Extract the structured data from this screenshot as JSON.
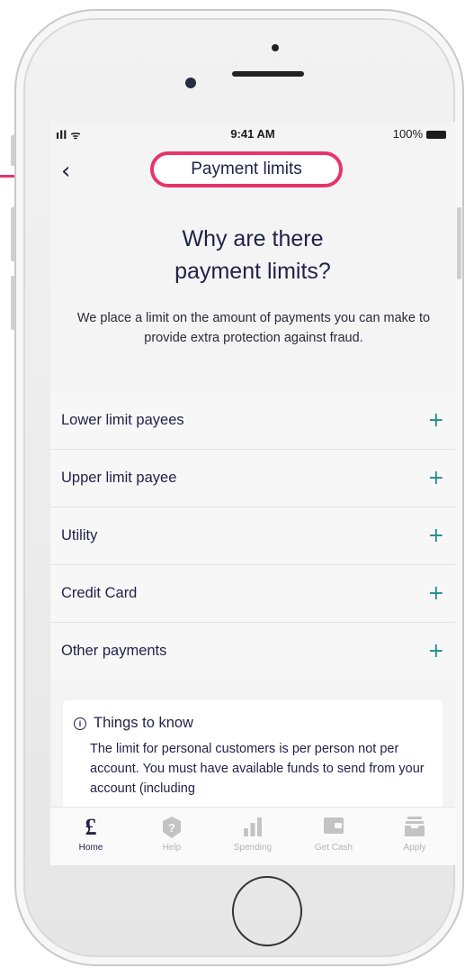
{
  "status": {
    "signal": "ıll ᯤ",
    "time": "9:41 AM",
    "battery": "100%"
  },
  "nav": {
    "title": "Payment limits",
    "back_icon": "chevron-left-icon"
  },
  "hero": {
    "title_line1": "Why are there",
    "title_line2": "payment limits?",
    "description": "We place a limit on the amount of payments you can make to provide extra protection against fraud."
  },
  "accordion": [
    {
      "label": "Lower limit payees",
      "icon": "plus-icon"
    },
    {
      "label": "Upper limit payee",
      "icon": "plus-icon"
    },
    {
      "label": "Utility",
      "icon": "plus-icon"
    },
    {
      "label": "Credit Card",
      "icon": "plus-icon"
    },
    {
      "label": "Other payments",
      "icon": "plus-icon"
    }
  ],
  "info": {
    "heading": "Things to know",
    "body": "The limit for personal customers is per person not per account. You must have available funds to send from your account (including"
  },
  "tabs": [
    {
      "label": "Home",
      "icon": "pound-icon"
    },
    {
      "label": "Help",
      "icon": "question-icon"
    },
    {
      "label": "Spending",
      "icon": "bar-chart-icon"
    },
    {
      "label": "Get Cash",
      "icon": "wallet-icon"
    },
    {
      "label": "Apply",
      "icon": "inbox-icon"
    }
  ],
  "colors": {
    "accent": "#e8336b",
    "navy": "#1f2247",
    "teal": "#1f8d8a"
  }
}
